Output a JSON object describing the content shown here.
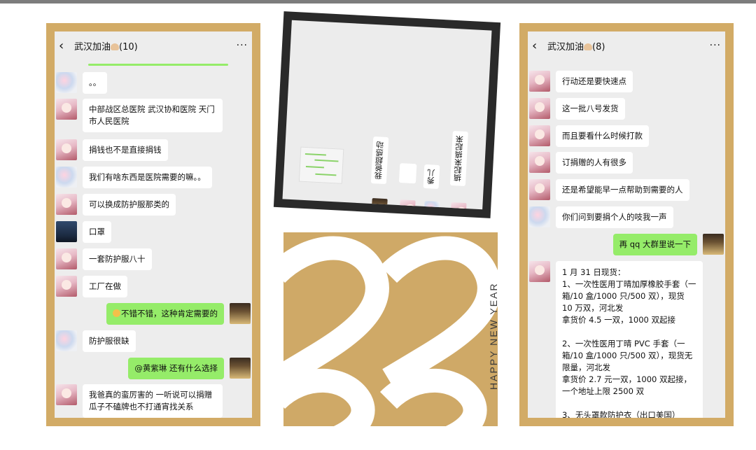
{
  "left_chat": {
    "title": "武汉加油",
    "count": "(10)",
    "messages": [
      {
        "side": "other",
        "avatar": "flower",
        "text": "。。"
      },
      {
        "side": "other",
        "avatar": "anime",
        "text": "中部战区总医院 武汉协和医院 天门市人民医院"
      },
      {
        "side": "other",
        "avatar": "anime",
        "text": "捐钱也不是直接捐钱"
      },
      {
        "side": "other",
        "avatar": "flower",
        "text": "我们有啥东西是医院需要的嘛。。"
      },
      {
        "side": "other",
        "avatar": "anime",
        "text": "可以换成防护服那类的"
      },
      {
        "side": "other",
        "avatar": "night",
        "text": "口罩"
      },
      {
        "side": "other",
        "avatar": "anime",
        "text": "一套防护服八十"
      },
      {
        "side": "other",
        "avatar": "anime",
        "text": "工厂在做"
      },
      {
        "side": "me",
        "avatar": "dark",
        "text": "不错不错，这种肯定需要的"
      },
      {
        "side": "other",
        "avatar": "flower",
        "text": "防护服很缺"
      },
      {
        "side": "me",
        "avatar": "dark",
        "text": "@黄紫琳  还有什么选择"
      },
      {
        "side": "other",
        "avatar": "anime",
        "text": "我爸真的蛮厉害的 一听说可以捐赠瓜子不磕牌也不打通宵找关系"
      }
    ]
  },
  "right_chat": {
    "title": "武汉加油",
    "count": "(8)",
    "messages": [
      {
        "side": "other",
        "avatar": "anime",
        "text": "行动还是要快速点"
      },
      {
        "side": "other",
        "avatar": "anime",
        "text": "这一批八号发货"
      },
      {
        "side": "other",
        "avatar": "anime",
        "text": "而且要看什么时候打款"
      },
      {
        "side": "other",
        "avatar": "anime",
        "text": "订捐赠的人有很多"
      },
      {
        "side": "other",
        "avatar": "anime",
        "text": "还是希望能早一点帮助到需要的人"
      },
      {
        "side": "other",
        "avatar": "flower",
        "text": "你们问到要捐个人的吱我一声"
      },
      {
        "side": "me",
        "avatar": "dark",
        "text": "再 qq 大群里说一下"
      },
      {
        "side": "other",
        "avatar": "anime",
        "text": "1 月 31 日现货：\n1、一次性医用丁晴加厚橡胶手套（一箱/10 盒/1000 只/500 双），现货 10 万双，河北发\n拿货价 4.5 一双，1000 双起接\n\n2、一次性医用丁晴 PVC 手套（一箱/10 盒/1000 只/500 双），现货无限量，河北发\n拿货价 2.7 元一双，1000 双起接，一个地址上限 2500 双\n\n3、无头罩款防护衣（出口美国）"
      }
    ]
  },
  "tilted_photo": {
    "bubbles": [
      "我爸超感动",
      "秀儿",
      "搞起来搞起来"
    ]
  },
  "new_year_card": {
    "digits": "2020",
    "text": "HAPPY NEW YEAR"
  },
  "colors": {
    "frame": "#d2ab66",
    "my_bubble": "#95ec69",
    "other_bubble": "#ffffff",
    "screen_bg": "#ededed"
  }
}
